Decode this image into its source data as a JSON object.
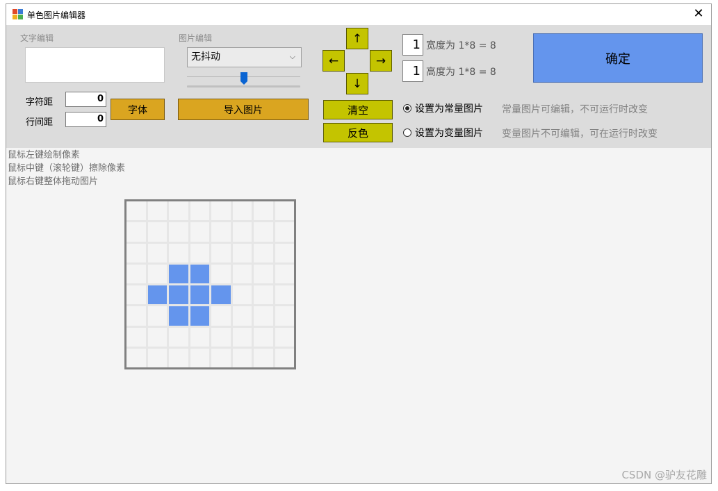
{
  "window": {
    "title": "单色图片编辑器",
    "close_label": "✕"
  },
  "text_panel": {
    "group_label": "文字编辑",
    "char_spacing_label": "字符距",
    "char_spacing_value": "0",
    "line_spacing_label": "行间距",
    "line_spacing_value": "0",
    "font_button": "字体"
  },
  "image_panel": {
    "group_label": "图片编辑",
    "dither_selected": "无抖动",
    "slider_value": 0.5,
    "import_button": "导入图片"
  },
  "nav": {
    "up": "↑",
    "left": "←",
    "right": "→",
    "down": "↓",
    "clear_button": "清空",
    "invert_button": "反色"
  },
  "size": {
    "width_value": "1",
    "width_text": "宽度为 1*8 = 8",
    "height_value": "1",
    "height_text": "高度为 1*8 = 8"
  },
  "mode": {
    "const_label": "设置为常量图片",
    "const_desc": "常量图片可编辑，不可运行时改变",
    "var_label": "设置为变量图片",
    "var_desc": "变量图片不可编辑，可在运行时改变",
    "selected": "const"
  },
  "confirm_button": "确定",
  "hints": [
    "鼠标左键绘制像素",
    "鼠标中键（滚轮键）擦除像素",
    "鼠标右键整体拖动图片"
  ],
  "pixel_grid": {
    "rows": 8,
    "cols": 8,
    "on_cells": [
      [
        3,
        2
      ],
      [
        3,
        3
      ],
      [
        4,
        1
      ],
      [
        4,
        2
      ],
      [
        4,
        3
      ],
      [
        4,
        4
      ],
      [
        5,
        2
      ],
      [
        5,
        3
      ]
    ],
    "on_color": "#6495ed"
  },
  "watermark": "CSDN @驴友花雕"
}
